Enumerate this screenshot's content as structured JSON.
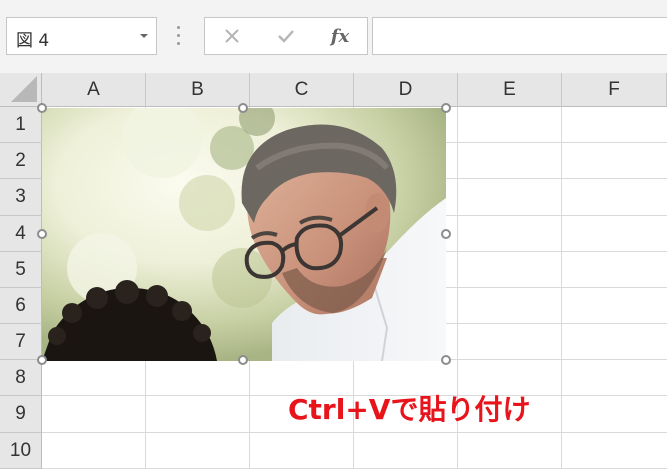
{
  "formula_bar": {
    "name_box_value": "図 4",
    "cancel_icon": "cross-icon",
    "enter_icon": "check-icon",
    "function_label": "fx",
    "formula_value": ""
  },
  "columns": [
    "A",
    "B",
    "C",
    "D",
    "E",
    "F"
  ],
  "rows": [
    "1",
    "2",
    "3",
    "4",
    "5",
    "6",
    "7",
    "8",
    "9",
    "10"
  ],
  "picture": {
    "subject": "photo",
    "selected": true
  },
  "annotation": {
    "text": "Ctrl+Vで貼り付け",
    "color": "#e8141b"
  },
  "colors": {
    "header_bg": "#e6e6e6",
    "gridline": "#d9d9d9",
    "handle_border": "#8c8c8c"
  }
}
